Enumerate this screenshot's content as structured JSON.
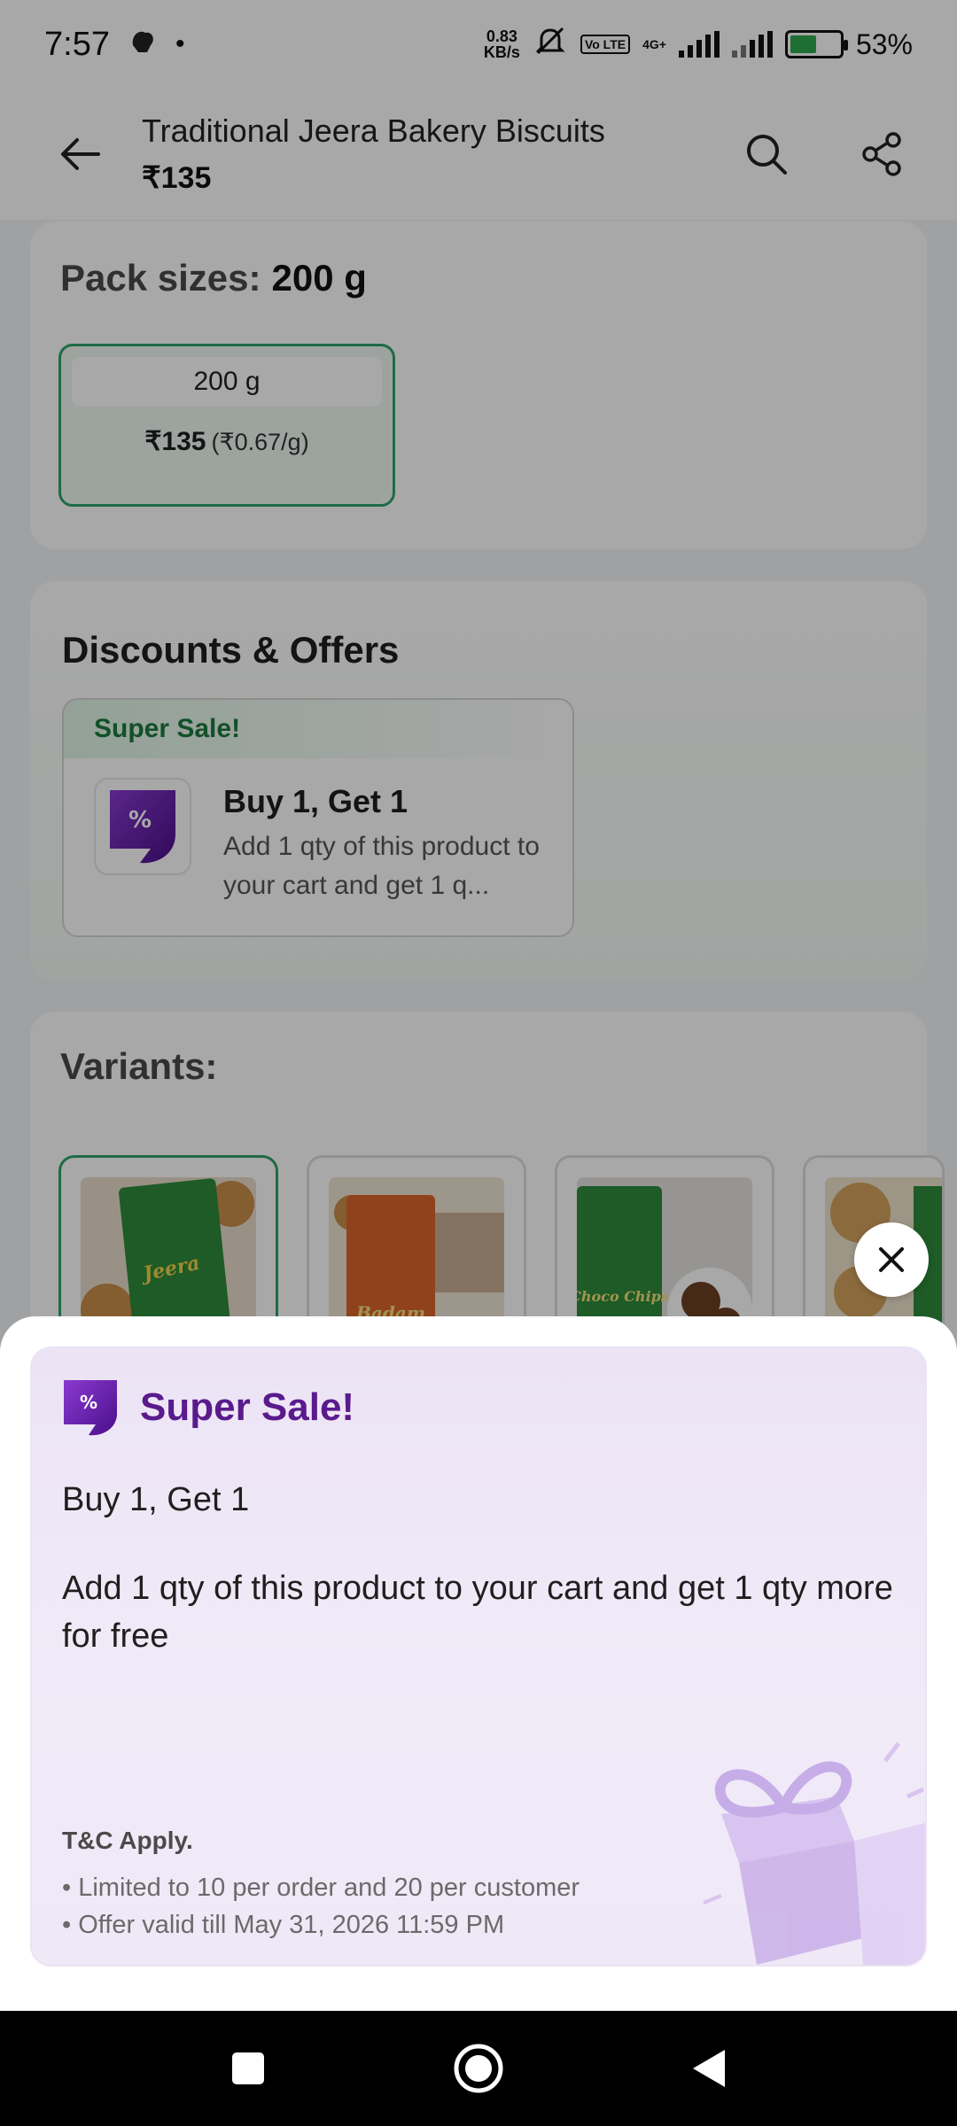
{
  "status_bar": {
    "time": "7:57",
    "net_speed_value": "0.83",
    "net_speed_unit": "KB/s",
    "volte_label": "Vo LTE",
    "network_label": "4G+",
    "battery": "53%",
    "battery_level": 0.53
  },
  "header": {
    "title": "Traditional Jeera Bakery Biscuits",
    "price": "₹135"
  },
  "pack_sizes": {
    "label": "Pack sizes:",
    "selected": "200 g",
    "options": [
      {
        "size": "200 g",
        "price": "₹135",
        "unit_price": "(₹0.67/g)"
      }
    ]
  },
  "offers": {
    "title": "Discounts & Offers",
    "tag": "Super Sale!",
    "offer_title": "Buy 1, Get 1",
    "offer_desc": "Add 1 qty of this product to your cart and get 1 q..."
  },
  "variants": {
    "title": "Variants:",
    "items": [
      {
        "name": "Jeera",
        "color": "#2e8b3a"
      },
      {
        "name": "Badam",
        "color": "#d9652b"
      },
      {
        "name": "Choco Chips",
        "color": "#2e8b3a"
      },
      {
        "name": "",
        "color": "#2e8b3a"
      }
    ]
  },
  "sheet": {
    "title": "Super Sale!",
    "offer_title": "Buy 1, Get 1",
    "offer_desc": "Add 1 qty of this product to your cart and get 1 qty more for free",
    "tc_title": "T&C Apply.",
    "tc_items": [
      "Limited to 10 per order and 20 per customer",
      "Offer valid till May 31, 2026 11:59 PM"
    ]
  },
  "colors": {
    "accent_green": "#2fa36b",
    "accent_purple": "#5a1a8c",
    "offer_icon": "#6a1fb0"
  }
}
